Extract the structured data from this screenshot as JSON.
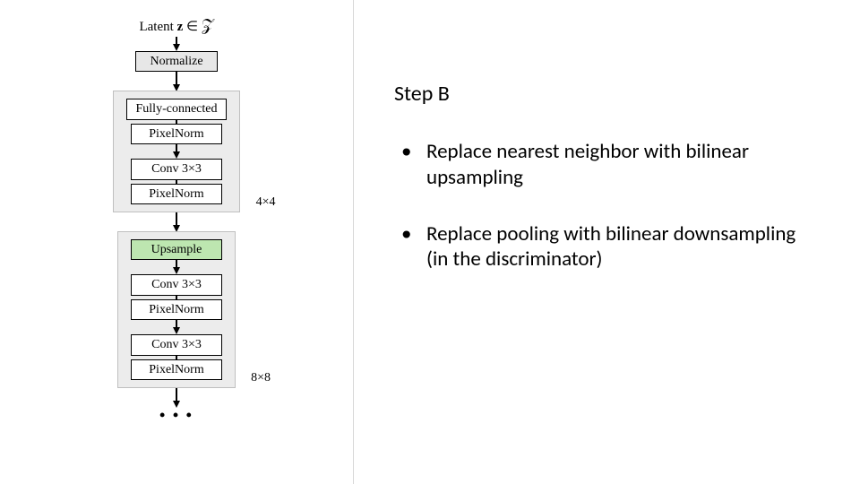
{
  "diagram": {
    "latent_prefix": "Latent ",
    "latent_z": "z",
    "latent_in": " ∈ ",
    "latent_set": "𝒵",
    "normalize": "Normalize",
    "block1": {
      "fc": "Fully-connected",
      "pn1": "PixelNorm",
      "conv": "Conv 3×3",
      "pn2": "PixelNorm",
      "size": "4×4"
    },
    "block2": {
      "upsample": "Upsample",
      "conv1": "Conv 3×3",
      "pn1": "PixelNorm",
      "conv2": "Conv 3×3",
      "pn2": "PixelNorm",
      "size": "8×8"
    },
    "ellipsis": "• • •"
  },
  "text": {
    "title": "Step B",
    "bullets": [
      "Replace nearest neighbor with bilinear upsampling",
      "Replace pooling with bilinear downsampling (in the discriminator)"
    ]
  }
}
